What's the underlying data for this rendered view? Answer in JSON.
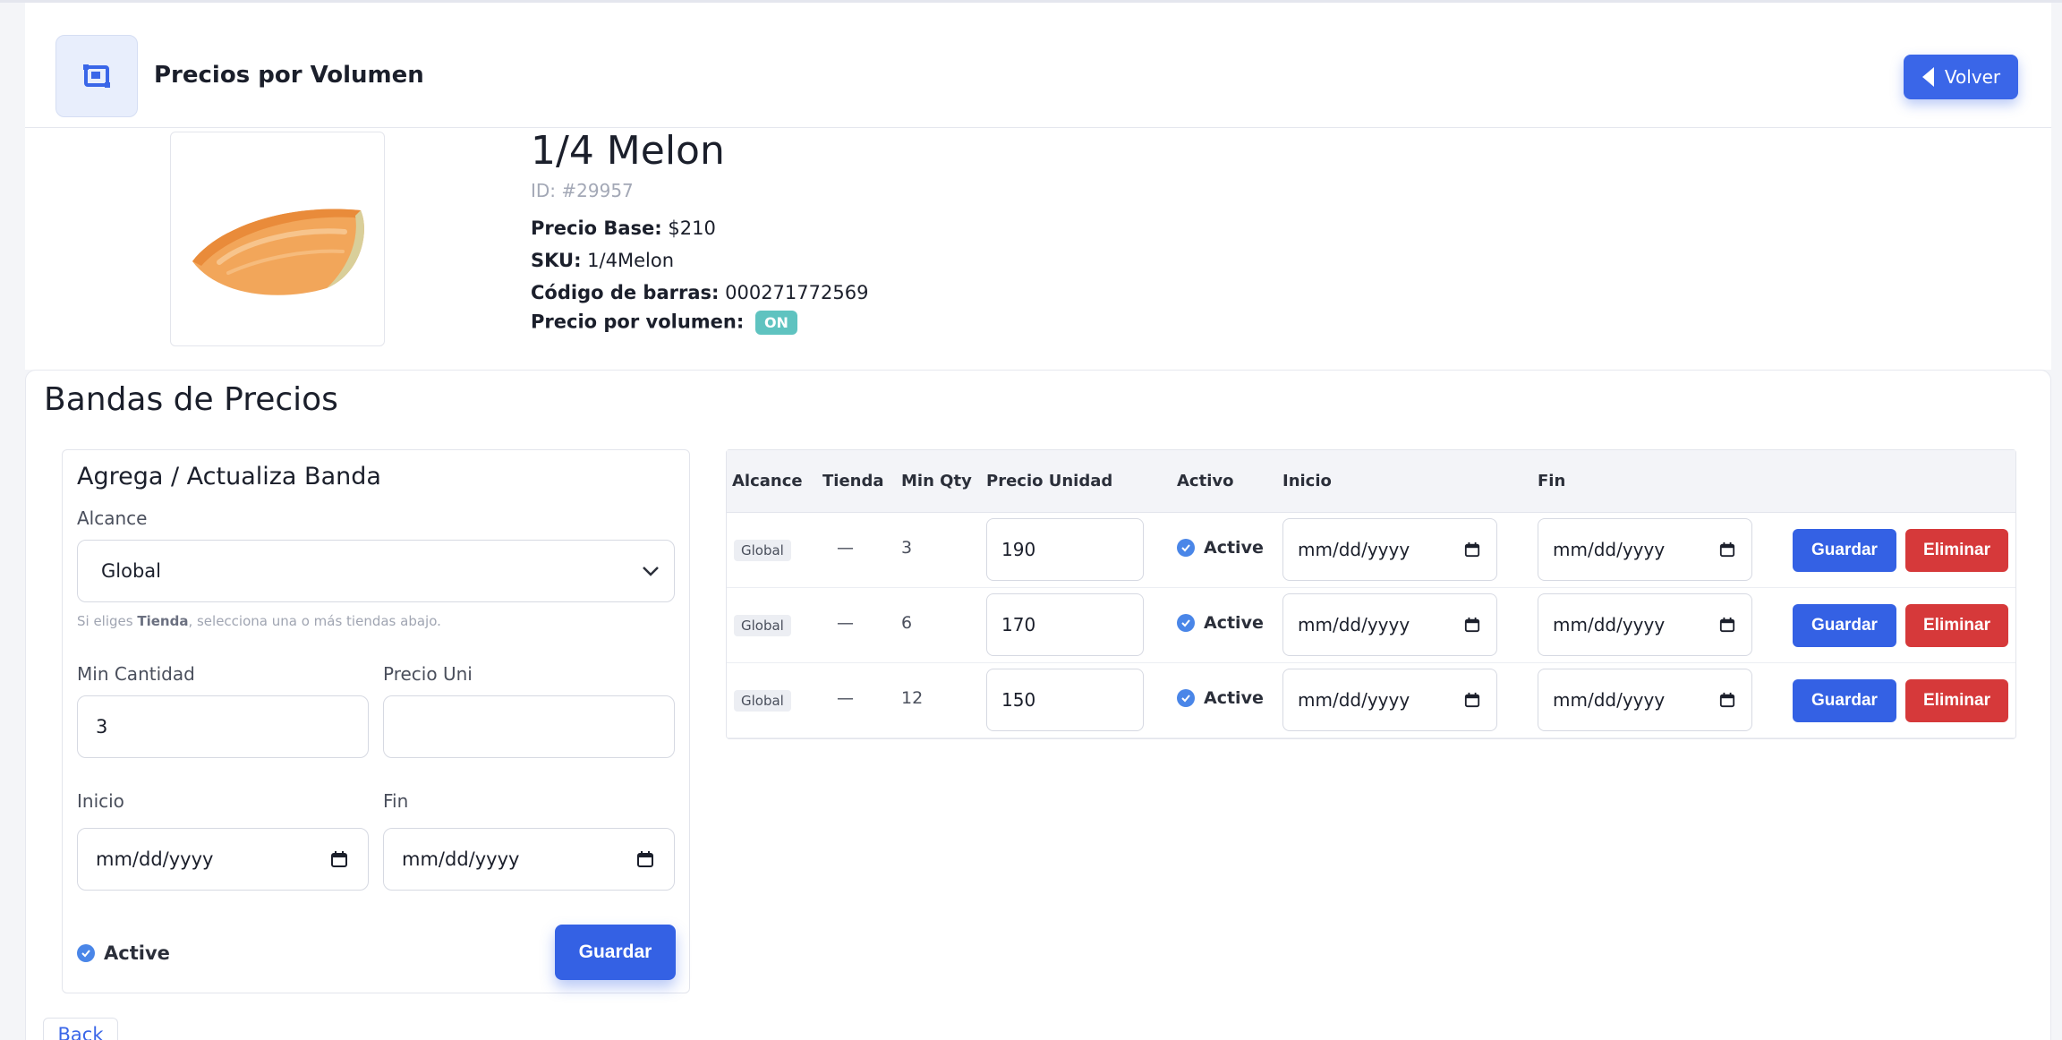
{
  "header": {
    "title": "Precios por Volumen",
    "back_label": "Volver"
  },
  "product": {
    "name": "1/4 Melon",
    "id_text": "ID: #29957",
    "base_price_label": "Precio Base:",
    "base_price_value": "$210",
    "sku_label": "SKU:",
    "sku_value": "1/4Melon",
    "barcode_label": "Código de barras:",
    "barcode_value": "000271772569",
    "volume_label": "Precio por volumen:",
    "volume_badge": "ON"
  },
  "bands": {
    "title": "Bandas de Precios"
  },
  "form": {
    "title": "Agrega / Actualiza Banda",
    "scope_label": "Alcance",
    "scope_value": "Global",
    "hint_prefix": "Si eliges ",
    "hint_bold": "Tienda",
    "hint_suffix": ", selecciona una o más tiendas abajo.",
    "min_qty_label": "Min Cantidad",
    "min_qty_value": "3",
    "unit_price_label": "Precio Uni",
    "unit_price_value": "",
    "start_label": "Inicio",
    "start_value": "mm/dd/yyyy",
    "end_label": "Fin",
    "end_value": "mm/dd/yyyy",
    "active_label": "Active",
    "save_label": "Guardar"
  },
  "table": {
    "headers": [
      "Alcance",
      "Tienda",
      "Min Qty",
      "Precio Unidad",
      "Activo",
      "Inicio",
      "Fin"
    ],
    "rows": [
      {
        "scope": "Global",
        "store": "—",
        "min_qty": "3",
        "price": "190",
        "active": "Active",
        "start": "mm/dd/yyyy",
        "end": "mm/dd/yyyy",
        "save": "Guardar",
        "delete": "Eliminar"
      },
      {
        "scope": "Global",
        "store": "—",
        "min_qty": "6",
        "price": "170",
        "active": "Active",
        "start": "mm/dd/yyyy",
        "end": "mm/dd/yyyy",
        "save": "Guardar",
        "delete": "Eliminar"
      },
      {
        "scope": "Global",
        "store": "—",
        "min_qty": "12",
        "price": "150",
        "active": "Active",
        "start": "mm/dd/yyyy",
        "end": "mm/dd/yyyy",
        "save": "Guardar",
        "delete": "Eliminar"
      }
    ]
  },
  "footer": {
    "back_label": "Back"
  },
  "colors": {
    "primary": "#3461e4",
    "danger": "#d6393a",
    "badge_on": "#5fc3c0",
    "check": "#4a86e8"
  }
}
